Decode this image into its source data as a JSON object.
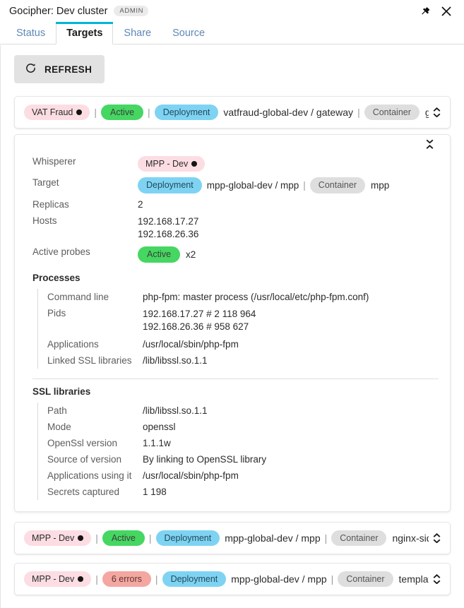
{
  "titlebar": {
    "title": "Gocipher: Dev cluster",
    "badge": "ADMIN",
    "pin_icon": "pin-icon",
    "close_icon": "close-icon"
  },
  "tabs": [
    {
      "label": "Status",
      "active": false
    },
    {
      "label": "Targets",
      "active": true
    },
    {
      "label": "Share",
      "active": false
    },
    {
      "label": "Source",
      "active": false
    }
  ],
  "toolbar": {
    "refresh_label": "REFRESH",
    "refresh_icon": "refresh-icon"
  },
  "rows": [
    {
      "tenant": "VAT Fraud",
      "status": "Active",
      "status_kind": "active",
      "kind": "Deployment",
      "path": "vatfraud-global-dev / gateway",
      "container_label": "Container",
      "container": "gateway"
    },
    {
      "tenant": "MPP - Dev",
      "status": "Active",
      "status_kind": "active",
      "kind": "Deployment",
      "path": "mpp-global-dev / mpp",
      "container_label": "Container",
      "container": "nginx-sidecar"
    },
    {
      "tenant": "MPP - Dev",
      "status": "6 errors",
      "status_kind": "errors",
      "kind": "Deployment",
      "path": "mpp-global-dev / mpp",
      "container_label": "Container",
      "container": "templates-sidecar"
    }
  ],
  "detail": {
    "whisperer_key": "Whisperer",
    "whisperer_value": "MPP - Dev",
    "target_key": "Target",
    "target_kind": "Deployment",
    "target_path": "mpp-global-dev / mpp",
    "target_container_label": "Container",
    "target_container": "mpp",
    "replicas_key": "Replicas",
    "replicas_value": "2",
    "hosts_key": "Hosts",
    "hosts_value": "192.168.17.27\n192.168.26.36",
    "probes_key": "Active probes",
    "probes_badge": "Active",
    "probes_count": "x2",
    "processes_title": "Processes",
    "process": {
      "cmdline_key": "Command line",
      "cmdline_value": "php-fpm: master process (/usr/local/etc/php-fpm.conf)",
      "pids_key": "Pids",
      "pids_value": "192.168.17.27 # 2 118 964\n192.168.26.36 # 958 627",
      "apps_key": "Applications",
      "apps_value": "/usr/local/sbin/php-fpm",
      "ssl_key": "Linked SSL libraries",
      "ssl_value": "/lib/libssl.so.1.1"
    },
    "ssl_title": "SSL libraries",
    "ssl": {
      "path_key": "Path",
      "path_value": "/lib/libssl.so.1.1",
      "mode_key": "Mode",
      "mode_value": "openssl",
      "version_key": "OpenSsl version",
      "version_value": "1.1.1w",
      "source_key": "Source of version",
      "source_value": "By linking to OpenSSL library",
      "apps_key": "Applications using it",
      "apps_value": "/usr/local/sbin/php-fpm",
      "secrets_key": "Secrets captured",
      "secrets_value": "1 198"
    }
  },
  "colors": {
    "accent": "#00b5d6",
    "tab_link": "#5f87b8",
    "pill_tenant": "#fcdde3",
    "pill_active": "#45d761",
    "pill_errors": "#f4a6a0",
    "pill_deployment": "#7fd3f2",
    "pill_container": "#dedede"
  }
}
